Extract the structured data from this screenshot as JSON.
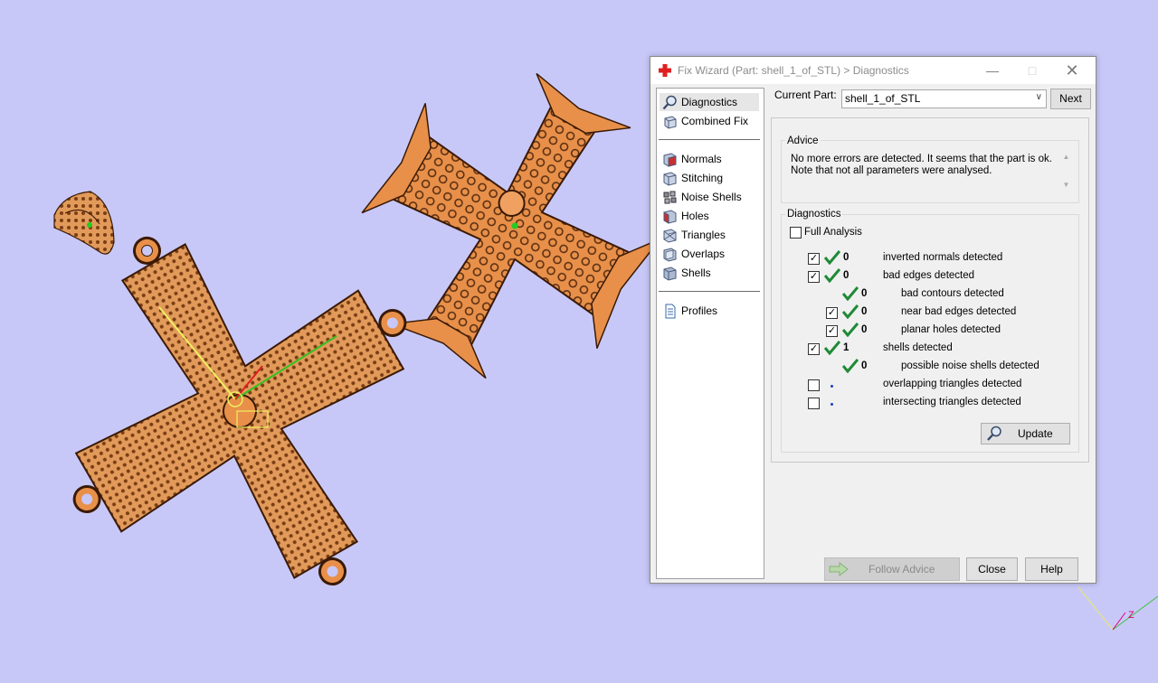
{
  "window": {
    "title": "Fix Wizard (Part: shell_1_of_STL) > Diagnostics",
    "minimize_glyph": "—",
    "maximize_glyph": "□",
    "close_glyph": "✕"
  },
  "nav": {
    "items": [
      {
        "label": "Diagnostics",
        "icon": "magnifier-icon"
      },
      {
        "label": "Combined Fix",
        "icon": "cube-icon"
      },
      {
        "label": "Normals",
        "icon": "normals-cube-icon"
      },
      {
        "label": "Stitching",
        "icon": "stitching-cube-icon"
      },
      {
        "label": "Noise Shells",
        "icon": "noise-shells-icon"
      },
      {
        "label": "Holes",
        "icon": "holes-cube-icon"
      },
      {
        "label": "Triangles",
        "icon": "triangles-cube-icon"
      },
      {
        "label": "Overlaps",
        "icon": "overlaps-cube-icon"
      },
      {
        "label": "Shells",
        "icon": "shells-cube-icon"
      },
      {
        "label": "Profiles",
        "icon": "document-icon"
      }
    ],
    "selected": "Diagnostics"
  },
  "current_part": {
    "label": "Current Part:",
    "value": "shell_1_of_STL",
    "chevron": "∨",
    "next_label": "Next"
  },
  "advice": {
    "title": "Advice",
    "line1": "No more errors are detected. It seems that the part is ok.",
    "line2": "Note that not all parameters were analysed.",
    "scroll_up": "▲",
    "scroll_down": "▼"
  },
  "diagnostics": {
    "title": "Diagnostics",
    "full_analysis_label": "Full Analysis",
    "rows": [
      {
        "count": "0",
        "text": "inverted normals detected",
        "checked": true
      },
      {
        "count": "0",
        "text": "bad edges detected",
        "checked": true
      },
      {
        "count": "0",
        "text": "bad contours detected"
      },
      {
        "count": "0",
        "text": "near bad edges detected",
        "checked": true
      },
      {
        "count": "0",
        "text": "planar holes detected",
        "checked": true
      },
      {
        "count": "1",
        "text": "shells detected",
        "checked": true
      },
      {
        "count": "0",
        "text": "possible noise shells detected"
      },
      {
        "count": "",
        "text": "overlapping triangles detected",
        "checked": false
      },
      {
        "count": "",
        "text": "intersecting triangles detected",
        "checked": false
      }
    ],
    "check_glyph": "✓",
    "update_label": "Update"
  },
  "buttons": {
    "follow_advice": "Follow Advice",
    "close": "Close",
    "help": "Help"
  },
  "viewport": {
    "background": "#c8c8f8",
    "part_color": "#e8904a",
    "axis_label": "Z"
  },
  "colors": {
    "tick_green": "#1e8a36",
    "dot_blue": "#1a3cc8",
    "close_red": "#e02020"
  }
}
